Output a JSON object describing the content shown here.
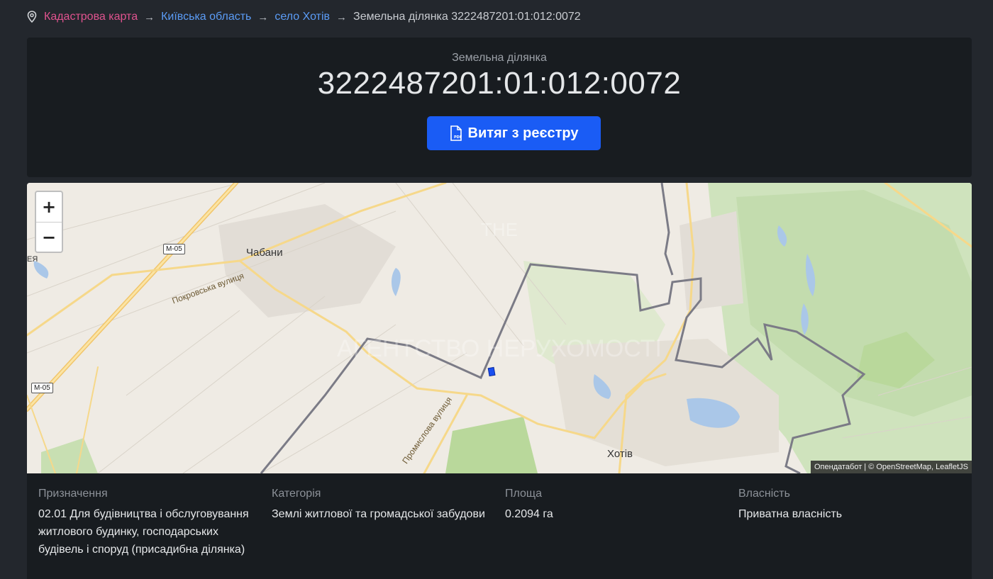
{
  "breadcrumb": {
    "items": [
      "Кадастрова карта",
      "Київська область",
      "село Хотів"
    ],
    "current": "Земельна ділянка 3222487201:01:012:0072",
    "separator": "→"
  },
  "header": {
    "subtitle": "Земельна ділянка",
    "title": "3222487201:01:012:0072",
    "button_label": "Витяг з реєстру"
  },
  "map": {
    "zoom_in": "+",
    "zoom_out": "−",
    "attribution": "Опендатабот | © OpenStreetMap, LeafletJS",
    "places": [
      "Чабани",
      "Хотів"
    ],
    "road_badges": [
      "М-05",
      "М-05"
    ],
    "streets": [
      "Покровська вулиця",
      "Промислова вулиця"
    ],
    "edge_label": "ЕЯ",
    "watermark_line1": "ТНЕ",
    "watermark_line2": "АГЕНТСТВО НЕРУХОМОСТІ"
  },
  "info": {
    "columns": [
      {
        "label": "Призначення",
        "value": "02.01 Для будівництва і обслуговування житлового будинку, господарських будівель і споруд (присадибна ділянка)"
      },
      {
        "label": "Категорія",
        "value": "Землі житлової та громадської забудови"
      },
      {
        "label": "Площа",
        "value": "0.2094 га"
      },
      {
        "label": "Власність",
        "value": "Приватна власність"
      }
    ]
  },
  "colors": {
    "page_bg": "#23272d",
    "card_bg": "#181c20",
    "button": "#1a5cf5",
    "breadcrumb_root": "#e0538f",
    "breadcrumb_link": "#5b9cf6"
  }
}
